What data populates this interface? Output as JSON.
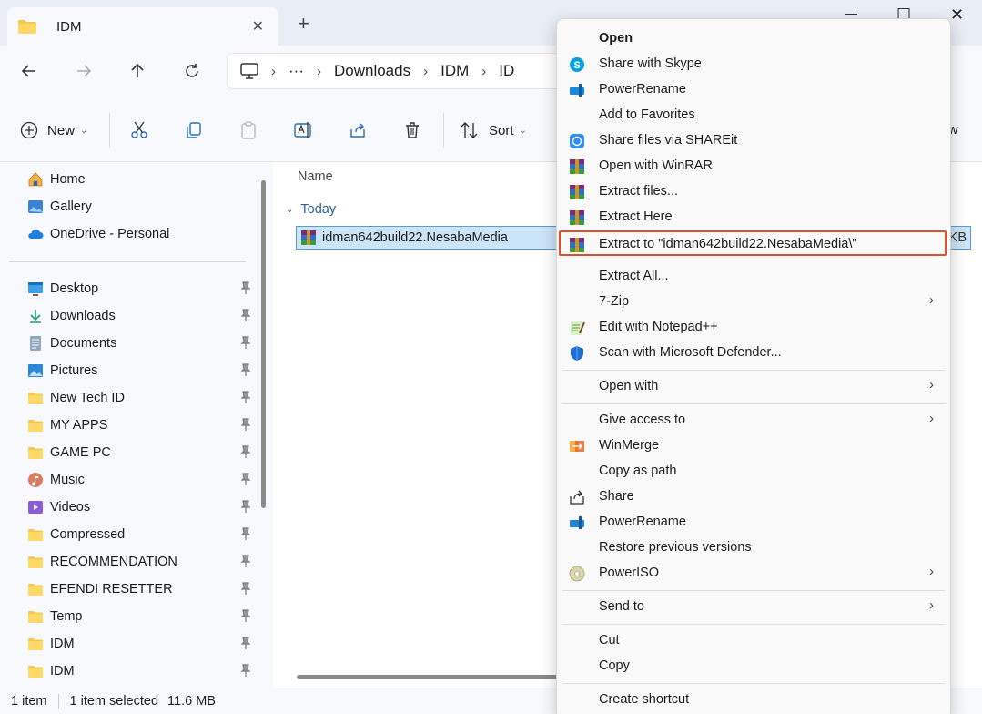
{
  "tab": {
    "title": "IDM",
    "close": "✕",
    "new_tab": "+"
  },
  "window_controls": {
    "minimize": "—",
    "maximize": "☐",
    "close": "✕"
  },
  "address": {
    "ellipsis": "···",
    "crumbs": [
      "Downloads",
      "IDM",
      "ID"
    ],
    "sep": "›"
  },
  "command_bar": {
    "new_label": "New",
    "sort_label": "Sort",
    "view_label": "w"
  },
  "sidebar": {
    "top": [
      {
        "label": "Home",
        "icon": "home-icon"
      },
      {
        "label": "Gallery",
        "icon": "gallery-icon"
      },
      {
        "label": "OneDrive - Personal",
        "icon": "cloud-icon"
      }
    ],
    "pinned": [
      {
        "label": "Desktop",
        "icon": "desktop-icon"
      },
      {
        "label": "Downloads",
        "icon": "download-icon"
      },
      {
        "label": "Documents",
        "icon": "document-icon"
      },
      {
        "label": "Pictures",
        "icon": "pictures-icon"
      },
      {
        "label": "New Tech ID",
        "icon": "folder-icon"
      },
      {
        "label": "MY APPS",
        "icon": "folder-icon"
      },
      {
        "label": "GAME PC",
        "icon": "folder-icon"
      },
      {
        "label": "Music",
        "icon": "music-icon"
      },
      {
        "label": "Videos",
        "icon": "video-icon"
      },
      {
        "label": "Compressed",
        "icon": "folder-icon"
      },
      {
        "label": "RECOMMENDATION",
        "icon": "folder-icon"
      },
      {
        "label": "EFENDI RESETTER",
        "icon": "folder-icon"
      },
      {
        "label": "Temp",
        "icon": "folder-icon"
      },
      {
        "label": "IDM",
        "icon": "folder-icon"
      },
      {
        "label": "IDM",
        "icon": "folder-icon"
      }
    ]
  },
  "content": {
    "column_name": "Name",
    "group": "Today",
    "file": {
      "name": "idman642build22.NesabaMedia",
      "size_fragment": "KB"
    }
  },
  "status": {
    "count": "1 item",
    "selected": "1 item selected",
    "size": "11.6 MB"
  },
  "context_menu": {
    "items": [
      {
        "label": "Open",
        "icon": "",
        "bold": true
      },
      {
        "label": "Share with Skype",
        "icon": "skype-icon"
      },
      {
        "label": "PowerRename",
        "icon": "powerrename-icon"
      },
      {
        "label": "Add to Favorites",
        "icon": ""
      },
      {
        "label": "Share files via SHAREit",
        "icon": "shareit-icon"
      },
      {
        "label": "Open with WinRAR",
        "icon": "winrar-icon"
      },
      {
        "label": "Extract files...",
        "icon": "winrar-icon"
      },
      {
        "label": "Extract Here",
        "icon": "winrar-icon"
      },
      {
        "label": "Extract to \"idman642build22.NesabaMedia\\\"",
        "icon": "winrar-icon",
        "highlight": true
      },
      {
        "sep": true
      },
      {
        "label": "Extract All...",
        "icon": ""
      },
      {
        "label": "7-Zip",
        "icon": "",
        "arrow": true
      },
      {
        "label": "Edit with Notepad++",
        "icon": "notepadpp-icon"
      },
      {
        "label": "Scan with Microsoft Defender...",
        "icon": "defender-icon"
      },
      {
        "sep": true
      },
      {
        "label": "Open with",
        "icon": "",
        "arrow": true
      },
      {
        "sep": true
      },
      {
        "label": "Give access to",
        "icon": "",
        "arrow": true
      },
      {
        "label": "WinMerge",
        "icon": "winmerge-icon"
      },
      {
        "label": "Copy as path",
        "icon": ""
      },
      {
        "label": "Share",
        "icon": "share-icon"
      },
      {
        "label": "PowerRename",
        "icon": "powerrename-icon"
      },
      {
        "label": "Restore previous versions",
        "icon": ""
      },
      {
        "label": "PowerISO",
        "icon": "poweriso-icon",
        "arrow": true
      },
      {
        "sep": true
      },
      {
        "label": "Send to",
        "icon": "",
        "arrow": true
      },
      {
        "sep": true
      },
      {
        "label": "Cut",
        "icon": ""
      },
      {
        "label": "Copy",
        "icon": ""
      },
      {
        "sep": true
      },
      {
        "label": "Create shortcut",
        "icon": ""
      }
    ],
    "submenu_arrow": "›"
  },
  "colors": {
    "highlight_border": "#e0502b",
    "selection_bg": "#cce4f7",
    "accent_blue": "#0067c0"
  }
}
